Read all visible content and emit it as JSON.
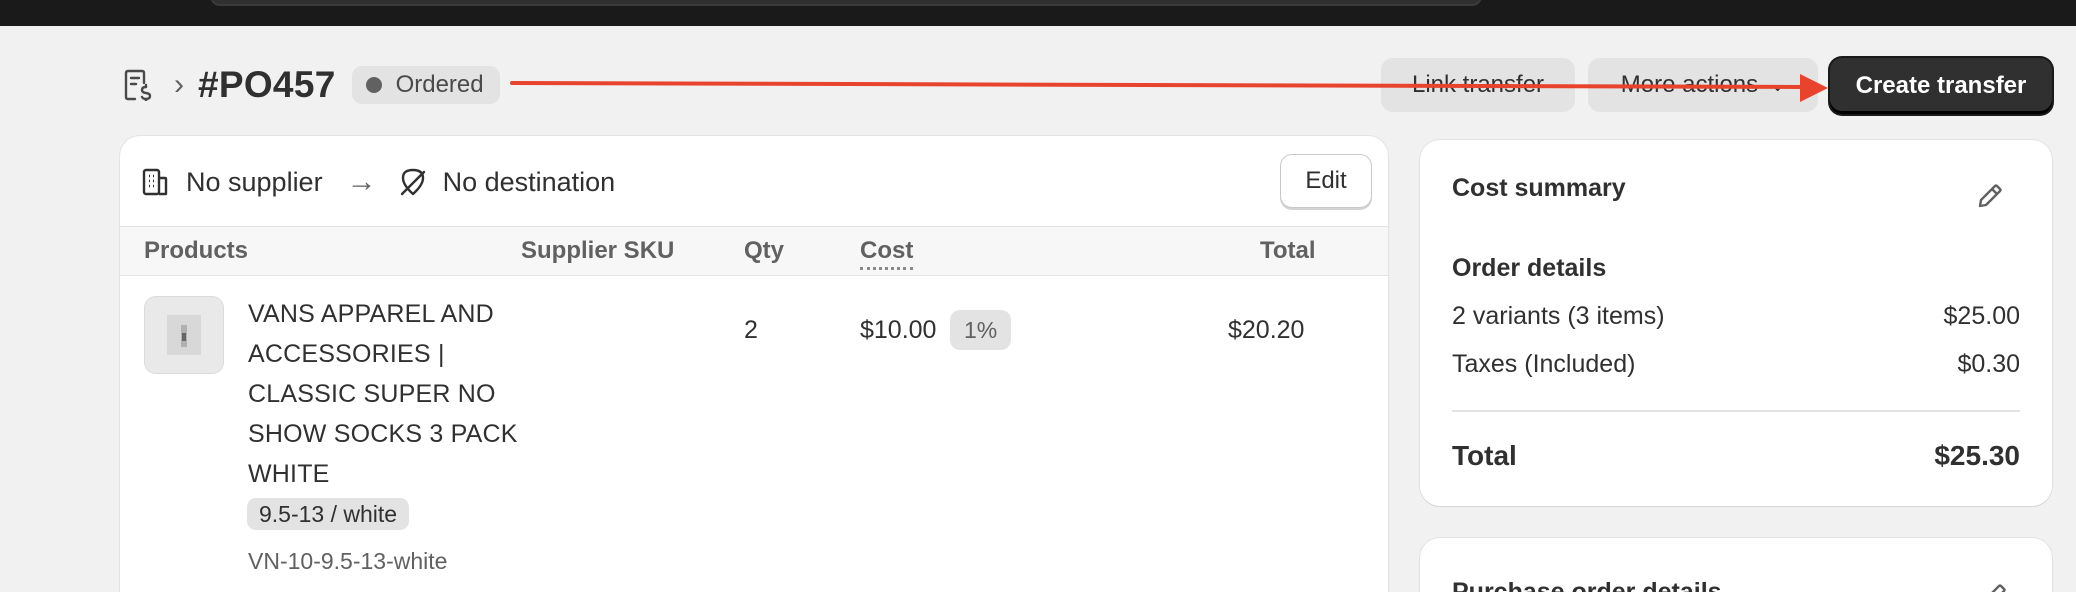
{
  "header": {
    "po_number": "#PO457",
    "status": "Ordered",
    "link_transfer_label": "Link transfer",
    "more_actions_label": "More actions",
    "create_transfer_label": "Create transfer"
  },
  "route": {
    "supplier": "No supplier",
    "destination": "No destination",
    "edit_label": "Edit"
  },
  "table": {
    "columns": [
      "Products",
      "Supplier SKU",
      "Qty",
      "Cost",
      "Total"
    ],
    "rows": [
      {
        "product_title": "VANS APPAREL AND ACCESSORIES | CLASSIC SUPER NO SHOW SOCKS 3 PACK WHITE",
        "variant": "9.5-13 / white",
        "sku": "VN-10-9.5-13-white",
        "supplier_sku": "",
        "qty": "2",
        "cost": "$10.00",
        "tax": "1%",
        "total": "$20.20"
      }
    ]
  },
  "summary": {
    "title": "Cost summary",
    "order_details_title": "Order details",
    "variants_label": "2 variants (3 items)",
    "variants_value": "$25.00",
    "taxes_label": "Taxes (Included)",
    "taxes_value": "$0.30",
    "total_label": "Total",
    "total_value": "$25.30"
  },
  "second_card": {
    "title": "Purchase order details"
  },
  "colors": {
    "annotation_arrow": "#e8432d",
    "primary_button": "#303030",
    "badge_bg": "#e3e3e3"
  },
  "icons": {
    "po": "receipt-dollar-icon",
    "supplier": "building-icon",
    "destination": "location-off-icon",
    "pencil": "pencil-icon"
  }
}
